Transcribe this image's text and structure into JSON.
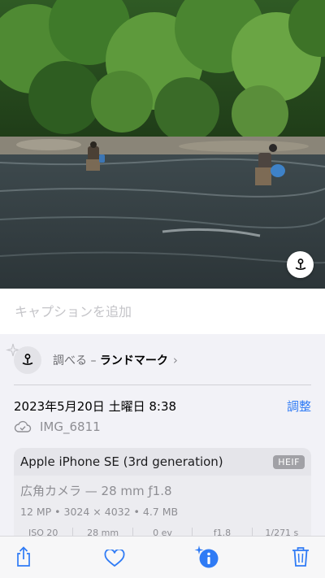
{
  "caption": {
    "placeholder": "キャプションを追加"
  },
  "lookup": {
    "prefix": "調べる –",
    "subject": "ランドマーク",
    "chevron": "›"
  },
  "date": {
    "text": "2023年5月20日 土曜日 8:38",
    "adjust_label": "調整"
  },
  "file": {
    "name": "IMG_6811",
    "icon": "cloud-check-icon"
  },
  "camera": {
    "device": "Apple iPhone SE (3rd generation)",
    "format": "HEIF",
    "lens": "広角カメラ — 28 mm ƒ1.8",
    "specs": "12 MP • 3024 × 4032 • 4.7 MB",
    "exif": [
      "ISO 20",
      "28 mm",
      "0 ev",
      "ƒ1.8",
      "1/271 s"
    ]
  },
  "toolbar": {
    "icons": [
      "share-icon",
      "heart-icon",
      "info-icon",
      "trash-icon"
    ]
  },
  "colors": {
    "accent": "#2f7bf5",
    "background": "#f2f2f7"
  }
}
